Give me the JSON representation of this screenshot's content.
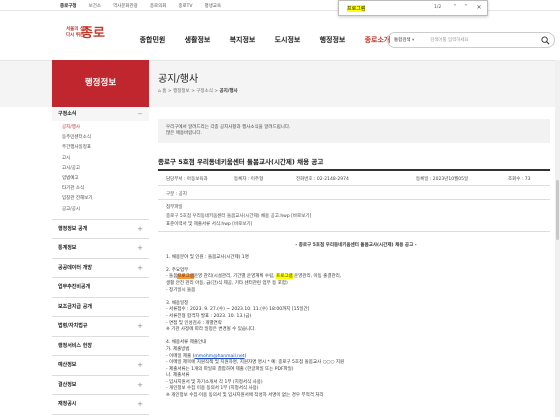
{
  "topbar": {
    "links": [
      "종로구청",
      "보건소",
      "역사문화관광",
      "종로의회",
      "종로TV",
      "평생교육"
    ]
  },
  "logo": {
    "small_line1": "서울의 심장",
    "small_line2": "다시 뛰는",
    "big": "종로"
  },
  "gnb": [
    "종합민원",
    "생활정보",
    "복지정보",
    "도시정보",
    "행정정보",
    "종로소개"
  ],
  "search": {
    "select_value": "통합검색",
    "placeholder": "검색어를 입력하세요"
  },
  "findbar": {
    "query": "프로그램",
    "count": "1/2"
  },
  "sidebar": {
    "title": "행정정보",
    "open_group": {
      "label": "구정소식",
      "mark": "−",
      "items": [
        "공지/행사",
        "동주민센터소식",
        "주간행사일정표",
        "고시",
        "고시/공고",
        "입법예고",
        "타기관 소식",
        "입찰관 전해보기",
        "공고/공시"
      ]
    },
    "items": [
      "행정정보 공개",
      "통계정보",
      "공공데이터 개방",
      "업무추진비공개",
      "보조금지급 공개",
      "법령/자치법규",
      "행정서비스 헌장",
      "예산정보",
      "결산정보",
      "재정공시"
    ]
  },
  "page": {
    "title": "공지/행사",
    "breadcrumb": [
      "홈",
      "행정정보",
      "구정소식",
      "공지/행사"
    ]
  },
  "intro": {
    "line1": "우리구에서 알려드리는 각종 공지사항과 행사소식을 알려드립니다.",
    "line2": "많은 애용바랍니다."
  },
  "post": {
    "title": "종로구 5호점 우리동네키움센터 돌봄교사(시간제) 채용 공고",
    "dept": "담당부서 : 아동보육과",
    "author": "등록자 : 이주형",
    "phone": "전화번호 : 02-2148-2974",
    "date": "등록일 : 2023년10월05일",
    "views": "조회수 : 73",
    "category": "구분 : 공지",
    "attach_label": "첨부파일",
    "files": [
      "종로구 5호점 우리동네키움센터 돌봄교사(시간제) 채용 공고.hwp     [바로보기]",
      "표준이력서 및 제출서류 서식.hwp     [바로보기]"
    ]
  },
  "body": {
    "heading": "- 종로구 5호점 우리동네키움센터 돌봄교사(시간제) 채용 공고 -",
    "lines": [
      "1. 채용분야 및 인원 : 돌봄교사(시간제) 1명",
      "",
      "2. 주요업무",
      "- 돌봄|프로그램|운영 관리(시설관리, 기간별 운영계획 수립, |프로그램| 운영관리, 아동 출결관리,",
      "                              생활 안전 관리 아동, 급(간)식 제공, 기타 센터관련 업무 등 포함)",
      "- 정기일시 돌봄",
      "",
      "3. 채용일정",
      "- 서류접수 : 2023. 9. 27.(수) ~ 2023.10. 11.(수) 18:00까지 [15일간]",
      "- 서류전형 합격자 발표 : 2023. 10. 13.(금)",
      "- 면접 및 인성검사 : 개별연락",
      "※ 기관 사정에 따라 일정은 변경될 수 있습니다.",
      "",
      "4. 채용서류 제출안내",
      "가. 제출방법",
      "- 이메일 제출 (|mmohm@hanmail.net|)",
      "- 이메일 제목에 지원직책 및 지원자명, 지원자명 명시  * 예: 종로구 5호점 돌봄교사 ○○○ 지원",
      "- 제출서류는 1개의 파일로 결합하여 제출 (한글파일 또는 PDF파일)",
      "나. 제출서류",
      "- 입사지원서 및 자기소개서 각 1부 (지정서식 사용)",
      "- 개인정보 수집 이용 동의서 1부 (지정서식 사용)",
      "※ 개인정보 수집·이용 동의서 및 입사지원서에 작성자 서명이 없는 경우 부적격 처리"
    ]
  },
  "colors": {
    "brand": "#c0262d",
    "highlight": "#ffff00",
    "highlight_current": "#ff9632"
  }
}
